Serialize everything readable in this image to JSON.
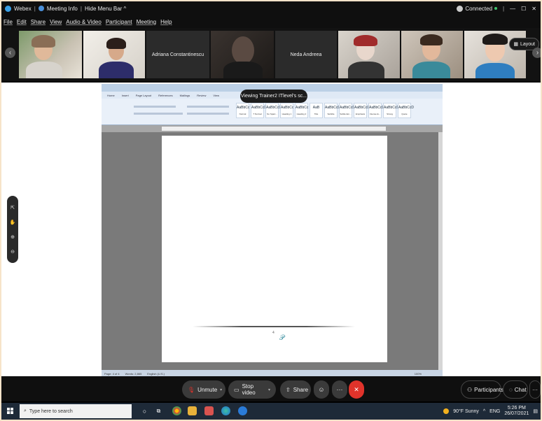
{
  "titlebar": {
    "app_name": "Webex",
    "meeting_info": "Meeting Info",
    "hide_menu_bar": "Hide Menu Bar ^",
    "connection_status": "Connected",
    "minimize": "—",
    "restore": "☐",
    "close": "✕"
  },
  "menu": [
    "File",
    "Edit",
    "Share",
    "View",
    "Audio & Video",
    "Participant",
    "Meeting",
    "Help"
  ],
  "participants": {
    "prev": "‹",
    "next": "›",
    "name_tiles": [
      "Adriana Constantinescu",
      "Neda Andreea"
    ],
    "layout_label": "Layout"
  },
  "share": {
    "viewing_label": "Viewing Trainer2 ITlevel's sc...",
    "word_tabs": [
      "Home",
      "Insert",
      "Page Layout",
      "References",
      "Mailings",
      "Review",
      "View"
    ],
    "styles": [
      {
        "sample": "AaBbCc",
        "name": "Normal"
      },
      {
        "sample": "AaBbCcD",
        "name": "T Normal"
      },
      {
        "sample": "AaBbCcD",
        "name": "No Spaci..."
      },
      {
        "sample": "AaBbCc",
        "name": "Heading 1"
      },
      {
        "sample": "AaBbCc",
        "name": "Heading 2"
      },
      {
        "sample": "AaB",
        "name": "Title"
      },
      {
        "sample": "AaBbCcD",
        "name": "Subtitle"
      },
      {
        "sample": "AaBbCcD",
        "name": "Subtle Em..."
      },
      {
        "sample": "AaBbCcD",
        "name": "Emphasis"
      },
      {
        "sample": "AaBbCcD",
        "name": "Intense E..."
      },
      {
        "sample": "AaBbCcD",
        "name": "Strong"
      },
      {
        "sample": "AaBbCcD",
        "name": "Quote"
      }
    ],
    "page_number": "4",
    "status_items": [
      "Page: 4 of 4",
      "Words: 2,865",
      "English (U.S.)"
    ],
    "zoom_level": "100%"
  },
  "zoom_tools": [
    "⇱",
    "✋",
    "⊕",
    "⊖"
  ],
  "controls": {
    "unmute": "Unmute",
    "stop_video": "Stop video",
    "share": "Share",
    "reactions": "☺",
    "more": "···",
    "leave": "✕",
    "participants": "Participants",
    "chat": "Chat",
    "more_right": "···"
  },
  "taskbar": {
    "search_placeholder": "Type here to search",
    "weather": "90°F Sunny",
    "language": "ENG",
    "time": "5:26 PM",
    "date": "26/07/2021"
  },
  "colors": {
    "leave_red": "#e0332b",
    "webex_blue": "#3aa0e6",
    "connected_green": "#3ec46d"
  }
}
